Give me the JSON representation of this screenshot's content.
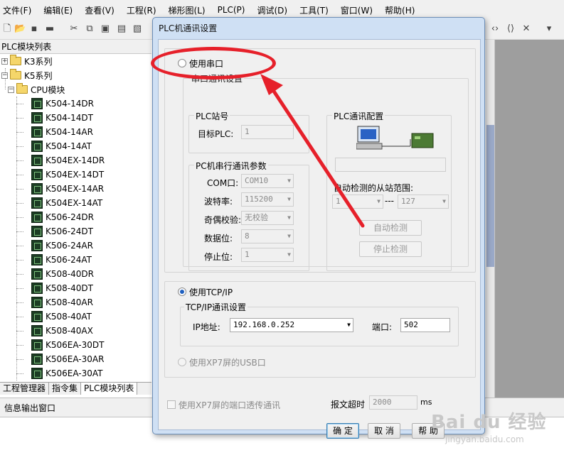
{
  "menu": [
    "文件(F)",
    "编辑(E)",
    "查看(V)",
    "工程(R)",
    "梯形图(L)",
    "PLC(P)",
    "调试(D)",
    "工具(T)",
    "窗口(W)",
    "帮助(H)"
  ],
  "left_panel": {
    "title": "PLC模块列表",
    "tree": {
      "series_k3": "K3系列",
      "series_k5": "K5系列",
      "cpu_module": "CPU模块",
      "models": [
        "K504-14DR",
        "K504-14DT",
        "K504-14AR",
        "K504-14AT",
        "K504EX-14DR",
        "K504EX-14DT",
        "K504EX-14AR",
        "K504EX-14AT",
        "K506-24DR",
        "K506-24DT",
        "K506-24AR",
        "K506-24AT",
        "K508-40DR",
        "K508-40DT",
        "K508-40AR",
        "K508-40AT",
        "K508-40AX",
        "K506EA-30DT",
        "K506EA-30AR",
        "K506EA-30AT"
      ]
    },
    "tabs": [
      "工程管理器",
      "指令集",
      "PLC模块列表"
    ],
    "active_tab": "PLC模块列表"
  },
  "info_output": "信息输出窗口",
  "dialog": {
    "title": "PLC机通讯设置",
    "use_serial": "使用串口",
    "serial_group": "串口通讯设置",
    "plc_station_group": "PLC站号",
    "target_plc_label": "目标PLC:",
    "target_plc_value": "1",
    "serial_params_group": "PC机串行通讯参数",
    "com_label": "COM口:",
    "com_value": "COM10",
    "baud_label": "波特率:",
    "baud_value": "115200",
    "parity_label": "奇偶校验:",
    "parity_value": "无校验",
    "databits_label": "数据位:",
    "databits_value": "8",
    "stopbits_label": "停止位:",
    "stopbits_value": "1",
    "plc_config_group": "PLC通讯配置",
    "auto_range_label": "自动检测的从站范围:",
    "range_from": "1",
    "range_sep": "---",
    "range_to": "127",
    "auto_detect_btn": "自动检测",
    "stop_detect_btn": "停止检测",
    "use_tcpip": "使用TCP/IP",
    "tcpip_group": "TCP/IP通讯设置",
    "ip_label": "IP地址:",
    "ip_value": "192.168.0.252",
    "port_label": "端口:",
    "port_value": "502",
    "use_xp7_usb": "使用XP7屏的USB口",
    "use_xp7_passthrough": "使用XP7屏的端口透传通讯",
    "timeout_label": "报文超时",
    "timeout_value": "2000",
    "timeout_unit": "ms",
    "ok_btn": "确 定",
    "cancel_btn": "取 消",
    "help_btn": "帮 助",
    "selected_mode": "tcpip"
  },
  "colors": {
    "annotation": "#e6202a",
    "dialog_frame": "#cfe0f4",
    "radio_dot": "#1f5fbf"
  },
  "watermark": {
    "brand": "Bai du 经验",
    "url": "jingyan.baidu.com"
  }
}
